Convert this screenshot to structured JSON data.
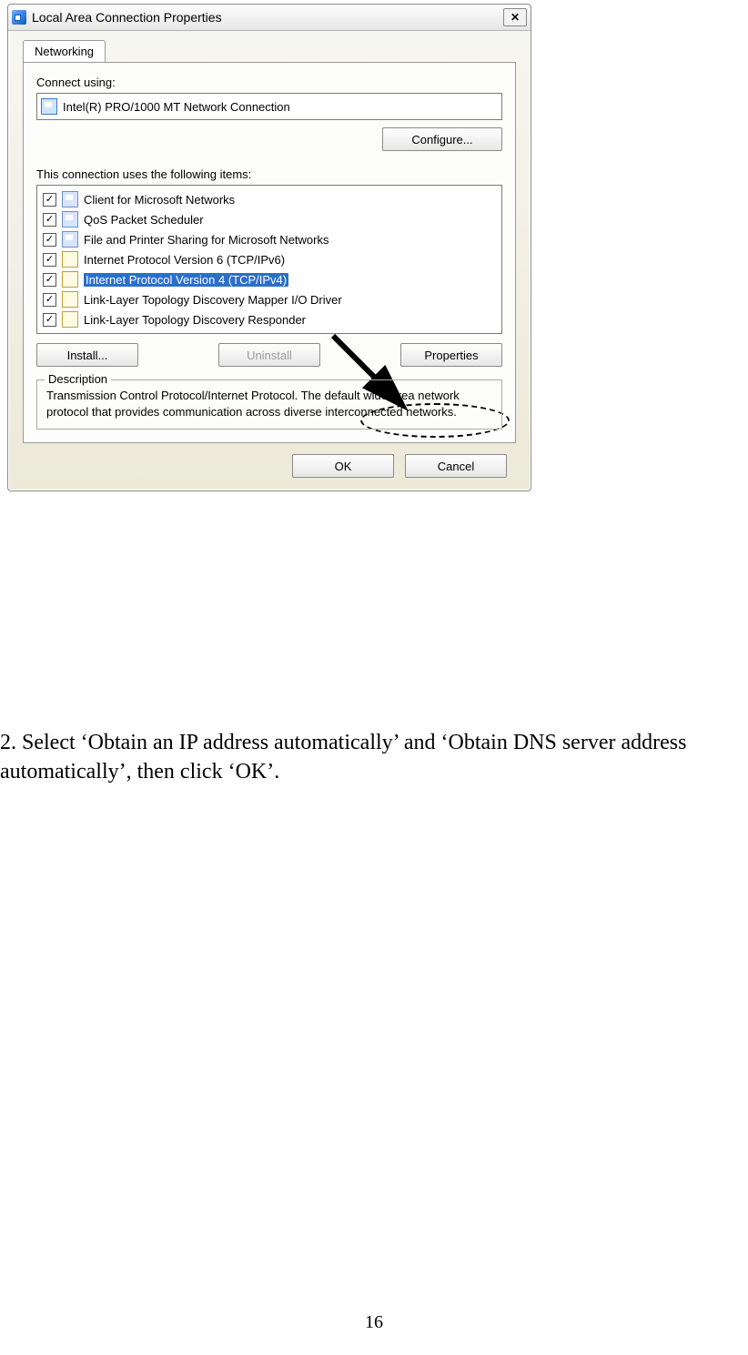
{
  "dialog": {
    "title": "Local Area Connection Properties",
    "tab": "Networking",
    "connect_label": "Connect using:",
    "adapter_name": "Intel(R) PRO/1000 MT Network Connection",
    "configure_btn": "Configure...",
    "items_label": "This connection uses the following items:",
    "items": [
      "Client for Microsoft Networks",
      "QoS Packet Scheduler",
      "File and Printer Sharing for Microsoft Networks",
      "Internet Protocol Version 6 (TCP/IPv6)",
      "Internet Protocol Version 4 (TCP/IPv4)",
      "Link-Layer Topology Discovery Mapper I/O Driver",
      "Link-Layer Topology Discovery Responder"
    ],
    "install_btn": "Install...",
    "uninstall_btn": "Uninstall",
    "properties_btn": "Properties",
    "group_label": "Description",
    "description": "Transmission Control Protocol/Internet Protocol. The default wide area network protocol that provides communication across diverse interconnected networks.",
    "ok_btn": "OK",
    "cancel_btn": "Cancel"
  },
  "instruction": "2. Select ‘Obtain an IP address automatically’ and ‘Obtain DNS server address automatically’, then click ‘OK’.",
  "page_number": "16"
}
